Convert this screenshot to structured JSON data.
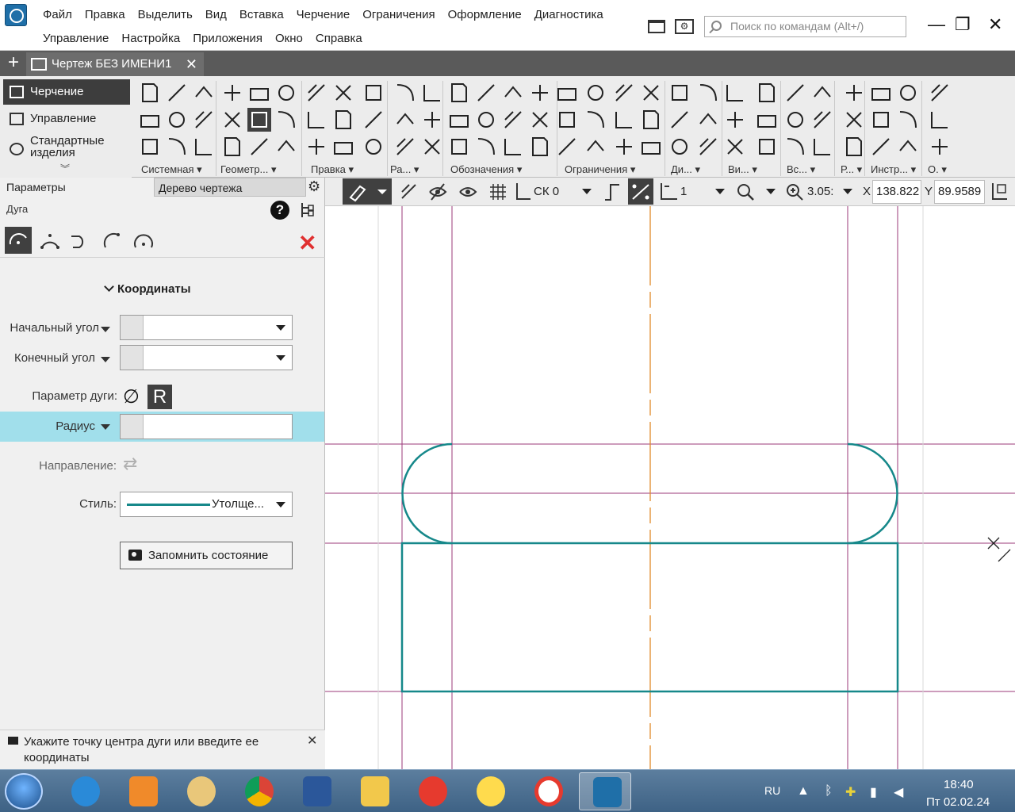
{
  "menu": {
    "row1": [
      "Файл",
      "Правка",
      "Выделить",
      "Вид",
      "Вставка",
      "Черчение",
      "Ограничения",
      "Оформление",
      "Диагностика"
    ],
    "row2": [
      "Управление",
      "Настройка",
      "Приложения",
      "Окно",
      "Справка"
    ]
  },
  "search": {
    "placeholder": "Поиск по командам (Alt+/)"
  },
  "window_controls": {
    "minimize": "—",
    "restore": "❐",
    "close": "✕"
  },
  "document_tab": {
    "title": "Чертеж БЕЗ ИМЕНИ1",
    "close": "✕",
    "add": "+"
  },
  "modes": {
    "drawing": "Черчение",
    "manage": "Управление",
    "std_items": "Стандартные изделия",
    "expand": "︾"
  },
  "ribbon_groups": [
    "Системная",
    "Геометр...",
    "Правка",
    "Ра...",
    "Обозначения",
    "Ограничения",
    "Ди...",
    "Ви...",
    "Вс...",
    "Р...",
    "Инстр...",
    "О."
  ],
  "panel": {
    "tab_params": "Параметры",
    "tab_tree": "Дерево чертежа",
    "command": "Дуга",
    "help": "?",
    "close": "✕",
    "section": "Координаты",
    "start_angle_label": "Начальный угол",
    "end_angle_label": "Конечный угол",
    "arc_param_label": "Параметр дуги:",
    "diameter_symbol": "∅",
    "radius_symbol": "R",
    "radius_label": "Радиус",
    "direction_label": "Направление:",
    "style_label": "Стиль:",
    "style_value": "Утолще...",
    "remember_button": "Запомнить состояние",
    "hint": "Укажите точку центра дуги или введите ее координаты"
  },
  "canvas_toolbar": {
    "cs": "СК 0",
    "layer": "1",
    "zoom": "3.05:",
    "x_label": "X",
    "x_value": "138.822",
    "y_label": "Y",
    "y_value": "89.9589"
  },
  "taskbar": {
    "lang": "RU",
    "time": "18:40",
    "date": "Пт 02.02.24"
  },
  "colors": {
    "geometry": "#16888a",
    "construction": "#9b3a7a",
    "axis": "#e08a2a",
    "highlight": "#a1dfeb"
  }
}
